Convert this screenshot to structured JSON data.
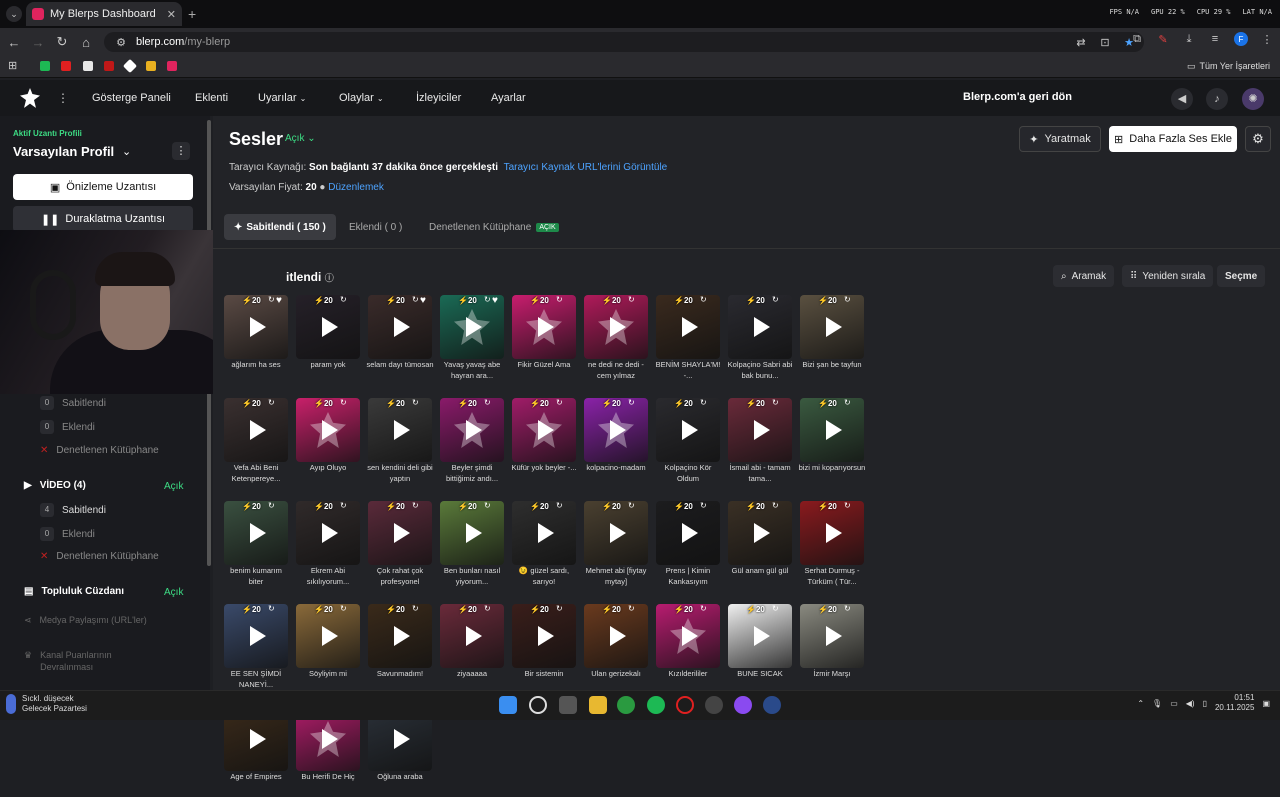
{
  "browser": {
    "tab_title": "My Blerps Dashboard",
    "new_tab": "+",
    "url_host": "blerp.com",
    "url_path": "/my-blerp",
    "bookmarks_all": "Tüm Yer İşaretleri",
    "perf": [
      {
        "label": "FPS",
        "value": "N/A"
      },
      {
        "label": "GPU",
        "value": "22 %"
      },
      {
        "label": "CPU",
        "value": "29 %"
      },
      {
        "label": "LAT",
        "value": "N/A"
      }
    ]
  },
  "header": {
    "menu": [
      "Gösterge Paneli",
      "Eklenti",
      "Uyarılar",
      "Olaylar",
      "İzleyiciler",
      "Ayarlar"
    ],
    "back": "Blerp.com'a geri dön"
  },
  "sidebar": {
    "profile_label": "Aktif Uzantı Profili",
    "profile_name": "Varsayılan Profil",
    "preview_btn": "Önizleme Uzantısı",
    "pause_btn": "Duraklatma Uzantısı",
    "sound_counts": [
      {
        "count": "0",
        "label": "Sabitlendi"
      },
      {
        "count": "0",
        "label": "Eklendi"
      }
    ],
    "sound_lib": "Denetlenen Kütüphane",
    "video_head": "VİDEO (4)",
    "video_status": "Açık",
    "video_counts": [
      {
        "count": "4",
        "label": "Sabitlendi"
      },
      {
        "count": "0",
        "label": "Eklendi"
      }
    ],
    "video_lib": "Denetlenen Kütüphane",
    "community_head": "Topluluk Cüzdanı",
    "community_status": "Açık",
    "media_share": "Medya Paylaşımı (URL'ler)",
    "channel_points": "Kanal Puanlarının Devralınması",
    "webcam_text": "logi"
  },
  "main": {
    "title": "Sesler",
    "title_status": "Açık",
    "create_btn": "Yaratmak",
    "add_btn": "Daha Fazla Ses Ekle",
    "source_label": "Tarayıcı Kaynağı:",
    "source_value": "Son bağlantı 37 dakika önce gerçekleşti",
    "source_link": "Tarayıcı Kaynak URL'lerini Görüntüle",
    "price_label": "Varsayılan Fiyat:",
    "price_value": "20",
    "price_edit": "Düzenlemek",
    "tabs": [
      "Sabitlendi ( 150 )",
      "Eklendi ( 0 )",
      "Denetlenen Kütüphane"
    ],
    "tab_badge": "AÇIK",
    "section_title": "itlendi",
    "search_btn": "Aramak",
    "reorder_btn": "Yeniden sırala",
    "select_btn": "Seçme"
  },
  "cards": [
    {
      "cap": "ağlarım ha ses",
      "c": "#5a4a44",
      "p": "20",
      "h": true
    },
    {
      "cap": "param yok",
      "c": "#252028",
      "p": "20",
      "h": false
    },
    {
      "cap": "selam dayı tümosan",
      "c": "#3a2b2a",
      "p": "20",
      "h": true
    },
    {
      "cap": "Yavaş yavaş abe hayran ara...",
      "c": "#1a6a55",
      "p": "20",
      "h": true,
      "s": true
    },
    {
      "cap": "Fikir Güzel Ama",
      "c": "#c81d6e",
      "p": "20",
      "h": false,
      "s": true
    },
    {
      "cap": "ne dedi ne dedi - cem yılmaz",
      "c": "#b01a5a",
      "p": "20",
      "h": false,
      "s": true
    },
    {
      "cap": "BENİM SHAYLA'M! -...",
      "c": "#3a2a1e",
      "p": "20",
      "h": false
    },
    {
      "cap": "Kolpaçino Sabri abi bak bunu...",
      "c": "#2a2a30",
      "p": "20",
      "h": false
    },
    {
      "cap": "Bizi şan be tayfun",
      "c": "#5a5040",
      "p": "20",
      "h": false
    },
    {
      "cap": "Vefa Abi Beni Ketenpereye...",
      "c": "#3a3030",
      "p": "20",
      "h": false
    },
    {
      "cap": "Ayıp Oluyo",
      "c": "#c8206a",
      "p": "20",
      "h": false,
      "s": true
    },
    {
      "cap": "sen kendini deli gibi yaptın",
      "c": "#3a3a3a",
      "p": "20",
      "h": false
    },
    {
      "cap": "Beyler şimdi bittiğimiz andı...",
      "c": "#8a1a6a",
      "p": "20",
      "h": false,
      "s": true
    },
    {
      "cap": "Küfür yok beyler -...",
      "c": "#a01c68",
      "p": "20",
      "h": false,
      "s": true
    },
    {
      "cap": "kolpacino-madam",
      "c": "#8a22a8",
      "p": "20",
      "h": false,
      "s": true
    },
    {
      "cap": "Kolpaçino Kör Oldum",
      "c": "#2a2a2e",
      "p": "20",
      "h": false
    },
    {
      "cap": "İsmail abi - tamam tama...",
      "c": "#6a2a3a",
      "p": "20",
      "h": false
    },
    {
      "cap": "bizi mi koparıyorsun",
      "c": "#3a5a40",
      "p": "20",
      "h": false
    },
    {
      "cap": "benim kumarım biter",
      "c": "#3a5040",
      "p": "20",
      "h": false
    },
    {
      "cap": "Ekrem Abi sıkılıyorum...",
      "c": "#302a2a",
      "p": "20",
      "h": false
    },
    {
      "cap": "Çok rahat çok profesyonel",
      "c": "#5a2a3a",
      "p": "20",
      "h": false
    },
    {
      "cap": "Ben bunları nasıl yiyorum...",
      "c": "#5a7a3a",
      "p": "20",
      "h": false
    },
    {
      "cap": "😉 güzel sardı, sarıyo!",
      "c": "#2e2e2e",
      "p": "20",
      "h": false
    },
    {
      "cap": "Mehmet abi [fiytay mytay]",
      "c": "#4a4030",
      "p": "20",
      "h": false
    },
    {
      "cap": "Prens | Kimin Kankasıyım",
      "c": "#1c1c1e",
      "p": "20",
      "h": false
    },
    {
      "cap": "Gül anam gül gül",
      "c": "#3a3025",
      "p": "20",
      "h": false
    },
    {
      "cap": "Serhat Durmuş - Türküm ( Tür...",
      "c": "#8a1a1e",
      "p": "20",
      "h": false
    },
    {
      "cap": "EE SEN ŞİMDİ NANEYİ...",
      "c": "#3a4a6a",
      "p": "20",
      "h": false
    },
    {
      "cap": "Söyliyim mi",
      "c": "#8a6a3a",
      "p": "20",
      "h": false
    },
    {
      "cap": "Savunmadım!",
      "c": "#3a2a1a",
      "p": "20",
      "h": false
    },
    {
      "cap": "ziyaaaaa",
      "c": "#6a2a3a",
      "p": "20",
      "h": false
    },
    {
      "cap": "Bir sistemin",
      "c": "#3a1e1a",
      "p": "20",
      "h": false
    },
    {
      "cap": "Ulan gerizekalı",
      "c": "#6a3a1e",
      "p": "20",
      "h": false
    },
    {
      "cap": "Kızılderililer",
      "c": "#b81c70",
      "p": "20",
      "h": false,
      "s": true
    },
    {
      "cap": "BUNE SICAK",
      "c": "#f0f0f0",
      "p": "20",
      "h": false
    },
    {
      "cap": "İzmir Marşı",
      "c": "#8a8a80",
      "p": "20",
      "h": false
    },
    {
      "cap": "Age of Empires",
      "c": "#3a2a1a",
      "p": "20",
      "h": false
    },
    {
      "cap": "Bu Herifi De Hiç",
      "c": "#b01c6a",
      "p": "20",
      "h": false,
      "s": true
    },
    {
      "cap": "Oğluna araba",
      "c": "#2a3038",
      "p": "20",
      "h": false
    }
  ],
  "taskbar": {
    "weather_line1": "Sıckl. düşecek",
    "weather_line2": "Gelecek Pazartesi",
    "time": "01:51",
    "date": "20.11.2025"
  }
}
